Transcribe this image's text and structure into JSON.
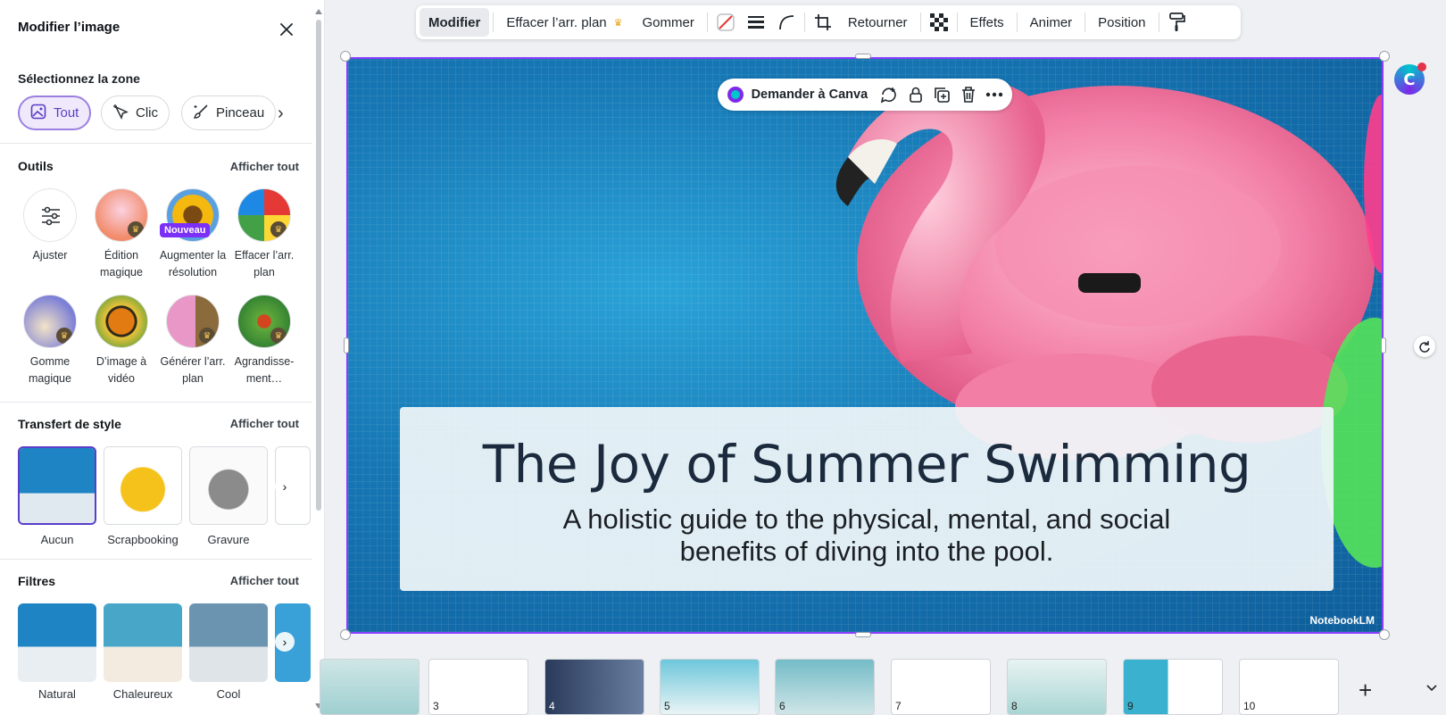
{
  "panel": {
    "title": "Modifier l’image",
    "zone": {
      "label": "Sélectionnez la zone",
      "buttons": [
        "Tout",
        "Clic",
        "Pinceau"
      ]
    },
    "tools": {
      "title": "Outils",
      "see_all": "Afficher tout",
      "items": [
        {
          "label": "Ajuster"
        },
        {
          "label": "Édition magique"
        },
        {
          "label": "Augmenter la résolution",
          "badge": "Nouveau"
        },
        {
          "label": "Effacer l’arr. plan"
        },
        {
          "label": "Gomme magique"
        },
        {
          "label": "D’image à vidéo"
        },
        {
          "label": "Générer l’arr. plan"
        },
        {
          "label": "Agrandisse­ment…"
        }
      ]
    },
    "style_transfer": {
      "title": "Transfert de style",
      "see_all": "Afficher tout",
      "items": [
        "Aucun",
        "Scrapbooking",
        "Gravure"
      ]
    },
    "filters": {
      "title": "Filtres",
      "see_all": "Afficher tout",
      "items": [
        "Natural",
        "Chaleureux",
        "Cool"
      ]
    }
  },
  "toolbar": {
    "edit": "Modifier",
    "remove_bg": "Effacer l’arr. plan",
    "erase": "Gommer",
    "flip": "Retourner",
    "effects": "Effets",
    "animate": "Animer",
    "position": "Position"
  },
  "ask_bar": {
    "label": "Demander à Canva"
  },
  "slide": {
    "title": "The Joy of Summer Swimming",
    "subtitle": "A holistic guide to the physical, mental, and social benefits of diving into the pool.",
    "logo": "NotebookLM"
  },
  "filmstrip": {
    "pages": [
      "3",
      "4",
      "5",
      "6",
      "7",
      "8",
      "9",
      "10"
    ]
  },
  "colors": {
    "accent": "#8b3dff",
    "water": "#1677b4",
    "flamingo": "#f07aa0"
  }
}
